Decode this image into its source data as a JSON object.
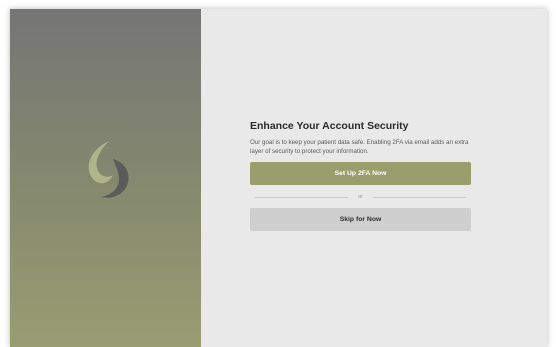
{
  "brand": {
    "logo_icon": "brand-swirl-icon",
    "logo_colors": [
      "#b0b48a",
      "#5b5b5b"
    ]
  },
  "security_prompt": {
    "title": "Enhance Your Account Security",
    "description": "Our goal is to keep your patient data safe. Enabling 2FA via email adds an extra layer of security to protect your information.",
    "setup_button_label": "Set Up 2FA Now",
    "divider_text": "or",
    "skip_button_label": "Skip for Now"
  },
  "colors": {
    "accent": "#9a9e6c",
    "panel_background": "#e9e9e9",
    "secondary_button": "#cfcfcf"
  }
}
